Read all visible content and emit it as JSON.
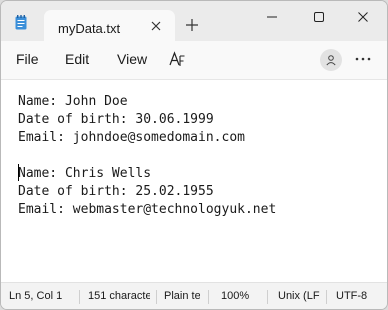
{
  "tab": {
    "title": "myData.txt"
  },
  "menu": {
    "file": "File",
    "edit": "Edit",
    "view": "View"
  },
  "editor": {
    "lines": [
      "Name: John Doe",
      "Date of birth: 30.06.1999",
      "Email: johndoe@somedomain.com",
      "",
      "Name: Chris Wells",
      "Date of birth: 25.02.1955",
      "Email: webmaster@technologyuk.net"
    ]
  },
  "status": {
    "position": "Ln 5, Col 1",
    "chars": "151 characte",
    "line_ending": "Plain te",
    "zoom": "100%",
    "eol": "Unix (LF",
    "encoding": "UTF-8"
  },
  "icons": {
    "app": "notepad-icon",
    "tab_close": "close-icon",
    "new_tab": "plus-icon",
    "minimize": "minimize-icon",
    "maximize": "maximize-icon",
    "close": "close-icon",
    "format": "font-format-icon",
    "profile": "account-icon",
    "more": "more-options-icon"
  }
}
